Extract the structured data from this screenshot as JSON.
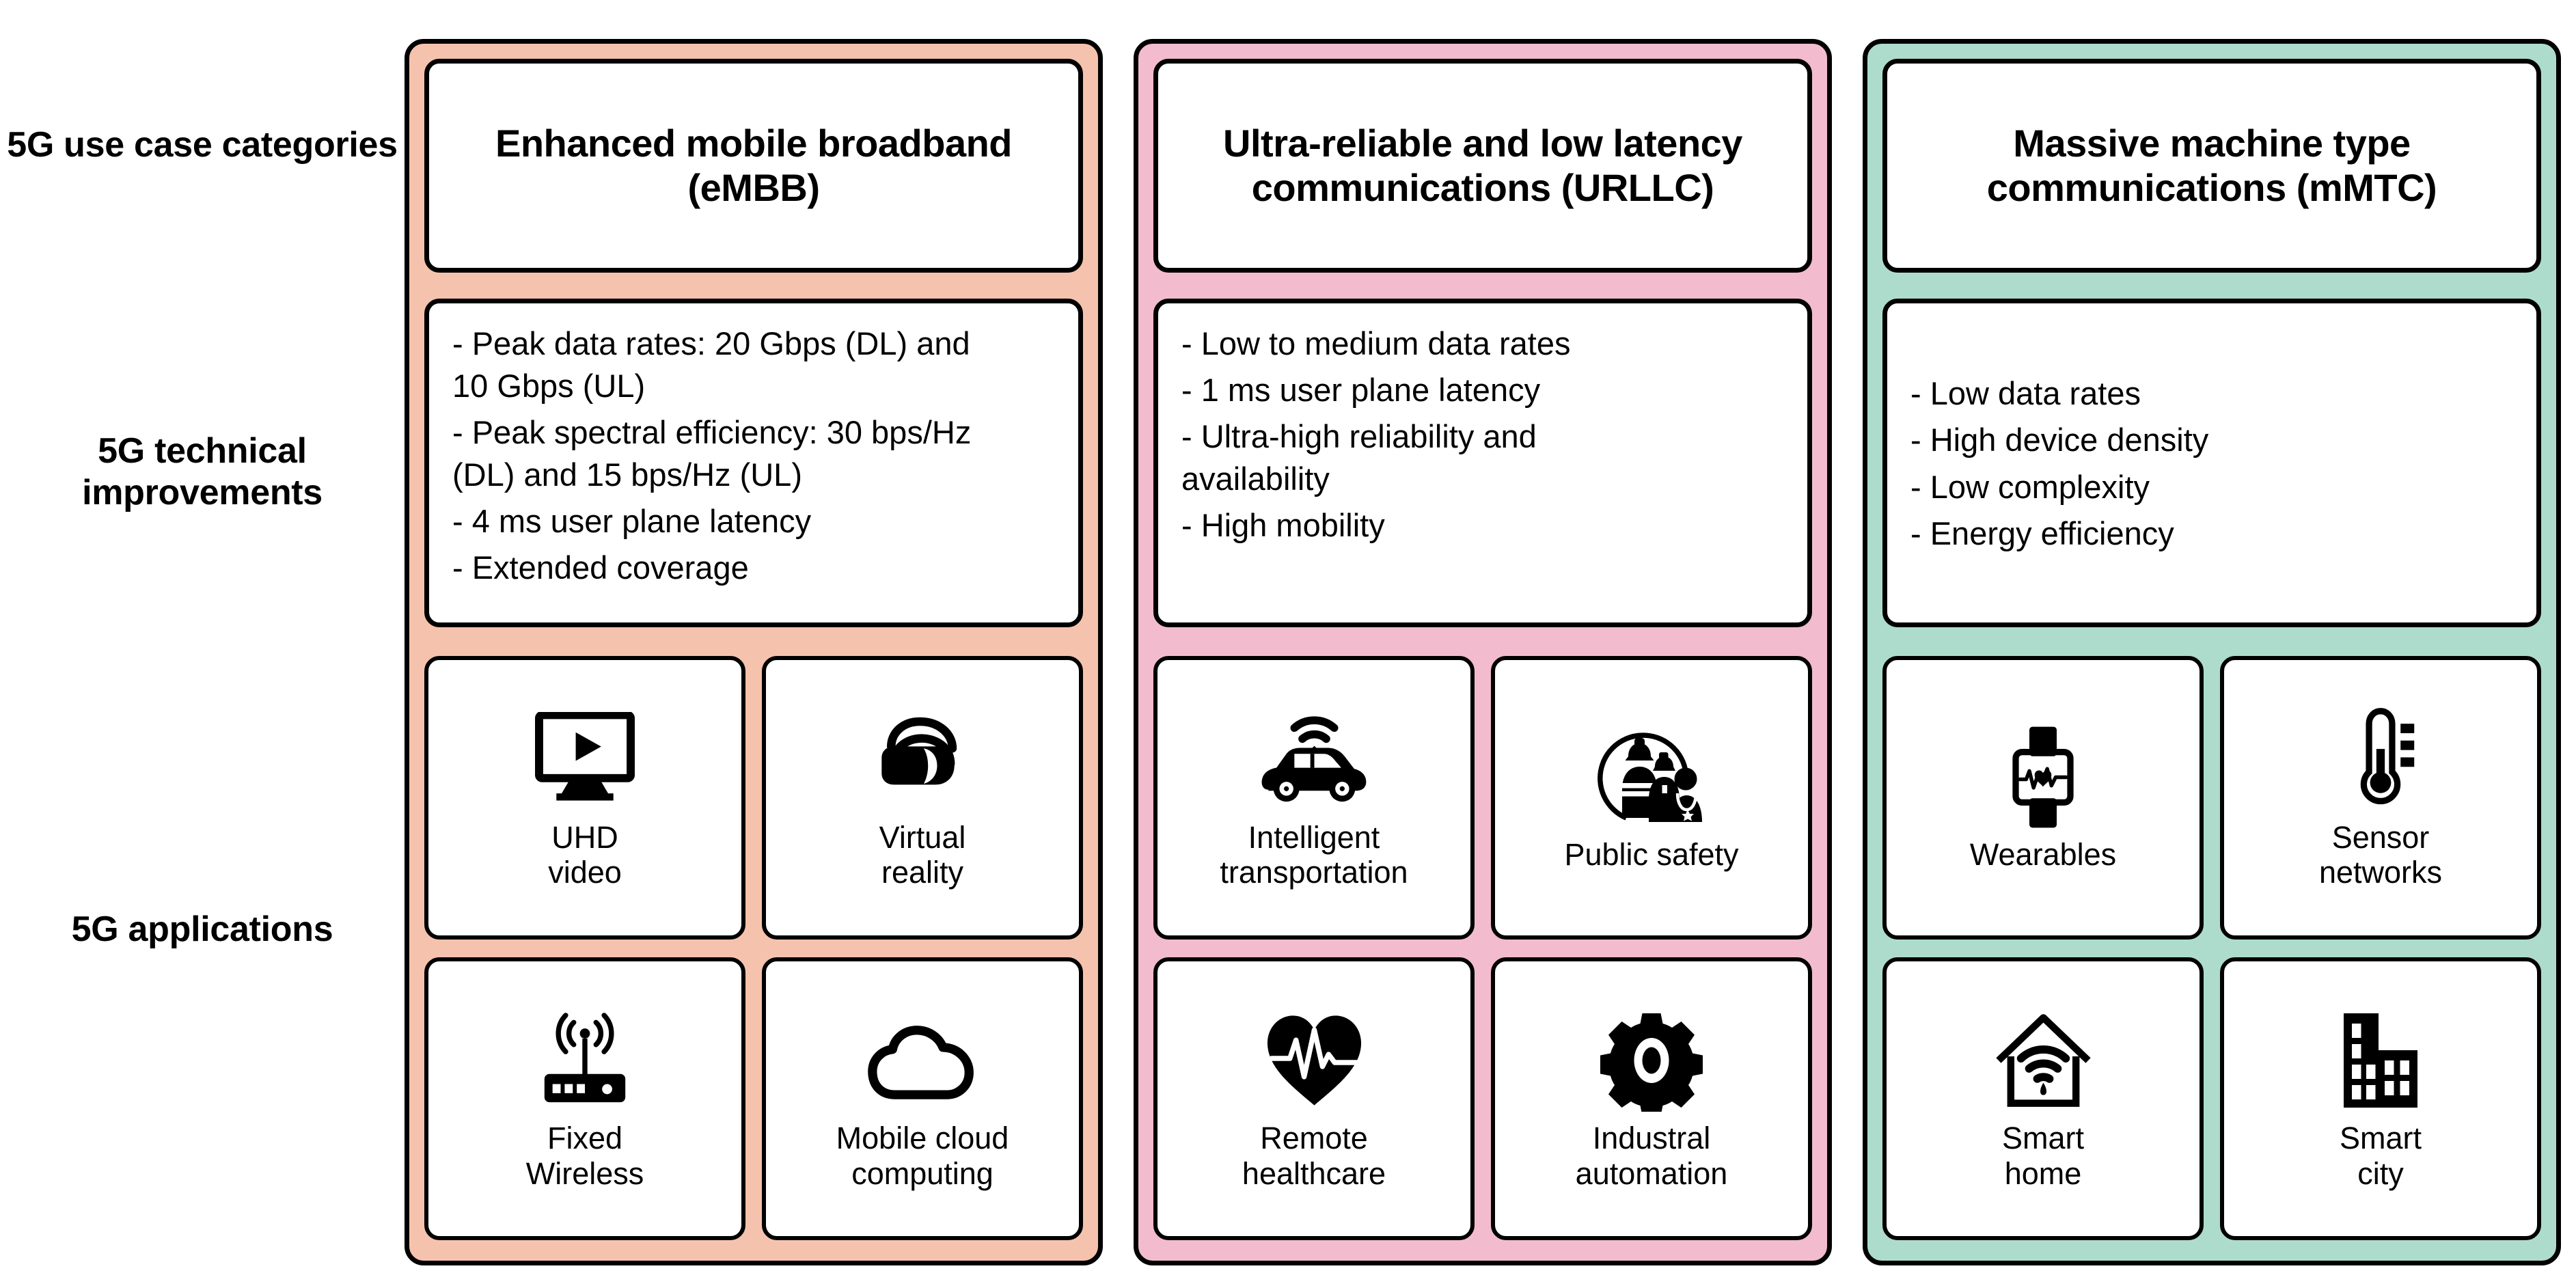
{
  "row_labels": [
    {
      "key": "categories",
      "text": "5G use case\ncategories"
    },
    {
      "key": "improvements",
      "text": "5G technical\nimprovements"
    },
    {
      "key": "applications",
      "text": "5G\napplications"
    }
  ],
  "colors": {
    "embb_panel": "#F5C3AD",
    "urllc_panel": "#F2BCCE",
    "mmtc_panel": "#AEDCCC",
    "card_background": "#FFFFFF",
    "outline": "#000000",
    "text": "#000000"
  },
  "columns": [
    {
      "id": "embb",
      "panel_color": "#F5C3AD",
      "header": "Enhanced mobile\nbroadband\n(eMBB)",
      "improvements": [
        "- Peak data rates: 20 Gbps (DL) and\n   10 Gbps (UL)",
        "- Peak spectral efficiency: 30 bps/Hz\n   (DL) and 15 bps/Hz (UL)",
        "- 4 ms user plane latency",
        "- Extended coverage"
      ],
      "applications": [
        {
          "label": "UHD\nvideo",
          "icon": "monitor-play-icon"
        },
        {
          "label": "Virtual\nreality",
          "icon": "vr-headset-icon"
        },
        {
          "label": "Fixed\nWireless",
          "icon": "wireless-router-icon"
        },
        {
          "label": "Mobile cloud\ncomputing",
          "icon": "cloud-icon"
        }
      ]
    },
    {
      "id": "urllc",
      "panel_color": "#F2BCCE",
      "header": "Ultra-reliable and low\nlatency communications\n(URLLC)",
      "improvements": [
        "- Low to medium data rates",
        "- 1 ms user plane latency",
        "- Ultra-high reliability and\n   availability",
        "- High mobility"
      ],
      "applications": [
        {
          "label": "Intelligent\ntransportation",
          "icon": "connected-car-icon"
        },
        {
          "label": "Public safety",
          "icon": "emergency-responders-icon"
        },
        {
          "label": "Remote\nhealthcare",
          "icon": "heart-pulse-icon"
        },
        {
          "label": "Industral\nautomation",
          "icon": "gear-icon"
        }
      ]
    },
    {
      "id": "mmtc",
      "panel_color": "#AEDCCC",
      "header": "Massive machine type\ncommunications\n(mMTC)",
      "improvements": [
        "- Low data rates",
        "- High device density",
        "- Low complexity",
        "- Energy efficiency"
      ],
      "applications": [
        {
          "label": "Wearables",
          "icon": "smartwatch-heartbeat-icon"
        },
        {
          "label": "Sensor\nnetworks",
          "icon": "thermometer-icon"
        },
        {
          "label": "Smart\nhome",
          "icon": "house-wifi-icon"
        },
        {
          "label": "Smart\ncity",
          "icon": "city-buildings-icon"
        }
      ]
    }
  ]
}
